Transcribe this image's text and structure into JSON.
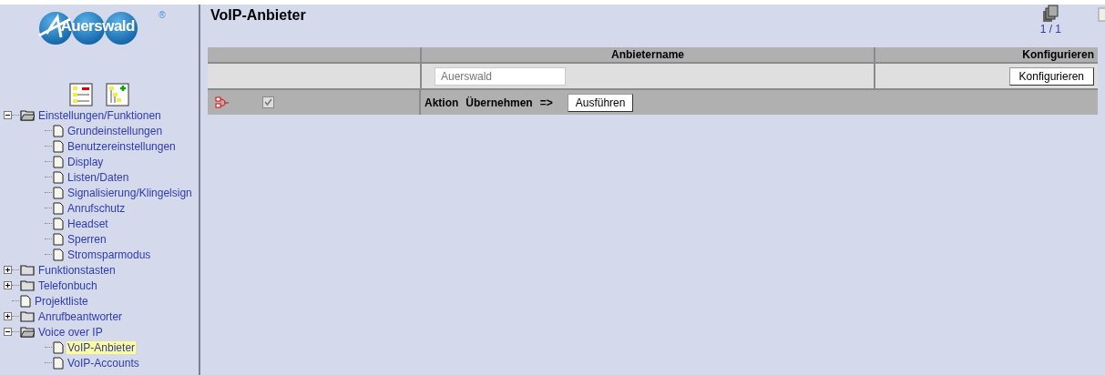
{
  "logo": {
    "text": "Auerswald",
    "mark": "®"
  },
  "tree": [
    {
      "label": "Einstellungen/Funktionen",
      "kind": "folder",
      "expanded": true,
      "selected": false,
      "children": [
        {
          "label": "Grundeinstellungen",
          "kind": "page",
          "selected": false
        },
        {
          "label": "Benutzereinstellungen",
          "kind": "page",
          "selected": false
        },
        {
          "label": "Display",
          "kind": "page",
          "selected": false
        },
        {
          "label": "Listen/Daten",
          "kind": "page",
          "selected": false
        },
        {
          "label": "Signalisierung/Klingelsign",
          "kind": "page",
          "selected": false
        },
        {
          "label": "Anrufschutz",
          "kind": "page",
          "selected": false
        },
        {
          "label": "Headset",
          "kind": "page",
          "selected": false
        },
        {
          "label": "Sperren",
          "kind": "page",
          "selected": false
        },
        {
          "label": "Stromsparmodus",
          "kind": "page",
          "selected": false
        }
      ]
    },
    {
      "label": "Funktionstasten",
      "kind": "folder",
      "expanded": false,
      "selected": false
    },
    {
      "label": "Telefonbuch",
      "kind": "folder",
      "expanded": false,
      "selected": false
    },
    {
      "label": "Projektliste",
      "kind": "page",
      "selected": false
    },
    {
      "label": "Anrufbeantworter",
      "kind": "folder",
      "expanded": false,
      "selected": false
    },
    {
      "label": "Voice over IP",
      "kind": "folder",
      "expanded": true,
      "selected": false,
      "children": [
        {
          "label": "VoIP-Anbieter",
          "kind": "page",
          "selected": true
        },
        {
          "label": "VoIP-Accounts",
          "kind": "page",
          "selected": false
        }
      ]
    }
  ],
  "page": {
    "title": "VoIP-Anbieter",
    "pager": "1 / 1"
  },
  "table": {
    "columns": [
      "Anbietername",
      "Konfigurieren"
    ],
    "rows": [
      {
        "name": "Auerswald",
        "button": "Konfigurieren"
      }
    ],
    "action": {
      "checked": true,
      "disabled": true,
      "label": "Aktion",
      "operation": "Übernehmen",
      "arrow": "=>",
      "button": "Ausführen"
    }
  }
}
